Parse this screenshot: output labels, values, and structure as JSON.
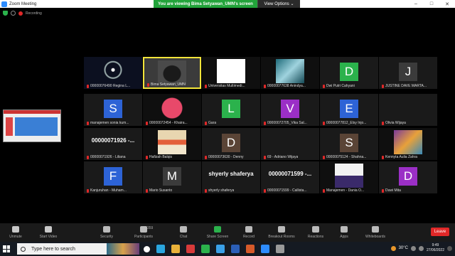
{
  "window": {
    "title": "Zoom Meeting",
    "controls": [
      "–",
      "□",
      "✕"
    ]
  },
  "share_banner": {
    "message": "You are viewing Bima Setyawan_UMN's screen",
    "view_options": "View Options ⌄"
  },
  "status": {
    "recording_label": "Recording",
    "grid_view": ""
  },
  "tiles": [
    {
      "name": "00000076490 Regina L...",
      "type": "photo",
      "bg": "#0c1020",
      "art": "clock"
    },
    {
      "name": "Bima Setyawan_UMN",
      "type": "photo",
      "bg": "#3b3b3b",
      "art": "face",
      "active": true
    },
    {
      "name": "Universitas Multimedi...",
      "type": "photo",
      "bg": "#0f0f0f",
      "art": "umn"
    },
    {
      "name": "00000077638 Anindya...",
      "type": "photo",
      "bg": "#0f0f0f",
      "art": "ocean"
    },
    {
      "name": "Dwi Putri Cahyani",
      "type": "letter",
      "letter": "D",
      "color": "#2bb24c"
    },
    {
      "name": "JUSTINE DAVE MARTA...",
      "type": "letter",
      "letter": "J",
      "color": "#3b3b3b"
    },
    {
      "name": "manajemen sonia kum...",
      "type": "letter",
      "letter": "S",
      "color": "#2d63d6"
    },
    {
      "name": "00000072454 - Khaira...",
      "type": "photo",
      "bg": "#0f0f0f",
      "art": "bear"
    },
    {
      "name": "Gara",
      "type": "letter",
      "letter": "L",
      "color": "#2bb24c"
    },
    {
      "name": "00000072705_Vika Sal...",
      "type": "letter",
      "letter": "V",
      "color": "#9b2fc6"
    },
    {
      "name": "00000077812_Elsy Injo...",
      "type": "letter",
      "letter": "E",
      "color": "#2d63d6"
    },
    {
      "name": "Olivia Wijaya",
      "type": "text",
      "text": ""
    },
    {
      "name": "00000071926 - Liliana",
      "type": "text",
      "text": "00000071926 -..."
    },
    {
      "name": "Hafizah Balqis",
      "type": "photo",
      "bg": "#0f0f0f",
      "art": "stamp"
    },
    {
      "name": "00000073630 - Denny",
      "type": "letter",
      "letter": "D",
      "color": "#5a4436"
    },
    {
      "name": "69 - Adriano Wijaya",
      "type": "text",
      "text": ""
    },
    {
      "name": "00000075124 - Shahna...",
      "type": "letter",
      "letter": "S",
      "color": "#5a4436"
    },
    {
      "name": "Kennyta Aulia Zahra",
      "type": "photo",
      "bg": "#0f0f0f",
      "art": "poster"
    },
    {
      "name": "Kanjuruhan - Muham...",
      "type": "letter",
      "letter": "F",
      "color": "#2d63d6"
    },
    {
      "name": "Mario Susanto",
      "type": "letter",
      "letter": "M",
      "color": "#3b3b3b"
    },
    {
      "name": "shyerly shaferya",
      "type": "text",
      "text": "shyerly shaferya"
    },
    {
      "name": "00000071599 - Callista...",
      "type": "text",
      "text": "00000071599 -..."
    },
    {
      "name": "Manajemen - Dania O...",
      "type": "photo",
      "bg": "#0f0f0f",
      "art": "card"
    },
    {
      "name": "Duwi Mita",
      "type": "letter",
      "letter": "D",
      "color": "#9b2fc6"
    }
  ],
  "toolbar": {
    "unmute": "Unmute",
    "start_video": "Start Video",
    "security": "Security",
    "participants": "Participants",
    "participants_count": "359",
    "chat": "Chat",
    "share_screen": "Share Screen",
    "record": "Record",
    "breakout_rooms": "Breakout Rooms",
    "reactions": "Reactions",
    "apps": "Apps",
    "whiteboards": "Whiteboards",
    "leave": "Leave"
  },
  "taskbar": {
    "search_placeholder": "Type here to search",
    "temperature": "30°C",
    "time": "9:49",
    "date": "27/06/2022"
  }
}
